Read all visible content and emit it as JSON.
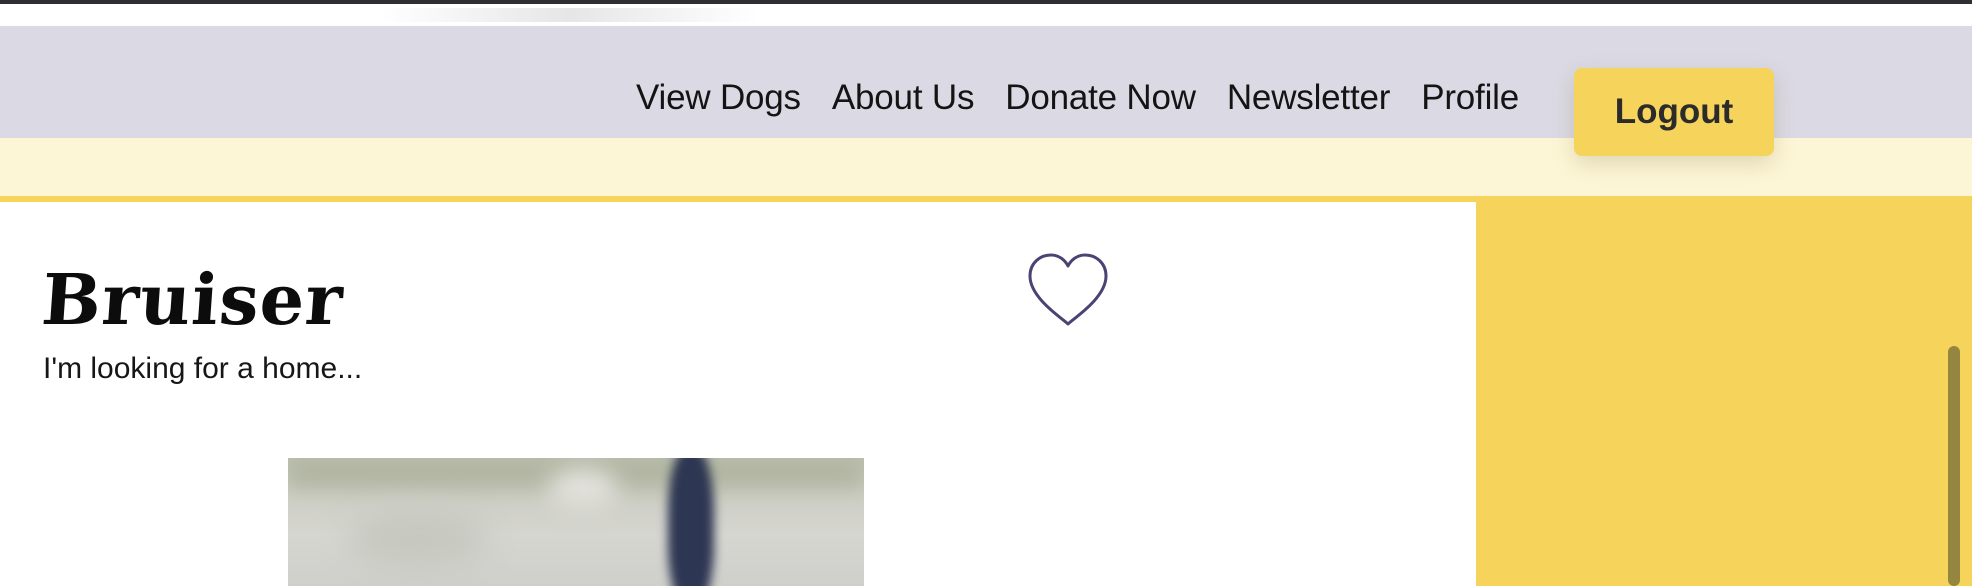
{
  "nav": {
    "links": [
      {
        "label": "View Dogs"
      },
      {
        "label": "About Us"
      },
      {
        "label": "Donate Now"
      },
      {
        "label": "Newsletter"
      },
      {
        "label": "Profile"
      }
    ],
    "logout_label": "Logout"
  },
  "dog": {
    "name": "Bruiser",
    "tagline": "I'm looking for a home..."
  },
  "icons": {
    "favorite": "heart-icon"
  },
  "colors": {
    "nav_bg": "#dbd9e3",
    "accent_yellow": "#f6d35a",
    "cream": "#fdf6d6",
    "heart_stroke": "#4a4373"
  }
}
